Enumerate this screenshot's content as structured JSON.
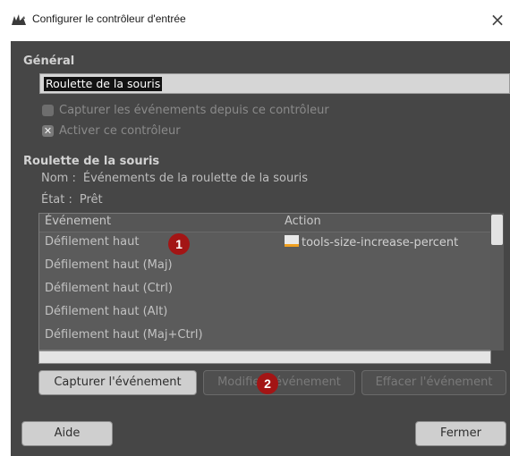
{
  "window": {
    "title": "Configurer le contrôleur d'entrée",
    "close_glyph": "×"
  },
  "general": {
    "heading": "Général",
    "name_value": "Roulette de la souris",
    "capture_label": "Capturer les événements depuis ce contrôleur",
    "capture_checked": false,
    "enable_label": "Activer ce contrôleur",
    "enable_checked": true,
    "enable_mark": "✕"
  },
  "controller": {
    "heading": "Roulette de la souris",
    "name_key": "Nom :",
    "name_value": "Événements de la roulette de la souris",
    "state_key": "État :",
    "state_value": "Prêt"
  },
  "events_table": {
    "columns": [
      "Événement",
      "Action"
    ],
    "rows": [
      {
        "event": "Défilement haut",
        "action": "tools-size-increase-percent",
        "action_icon": "action-icon"
      },
      {
        "event": "Défilement haut (Maj)",
        "action": ""
      },
      {
        "event": "Défilement haut (Ctrl)",
        "action": ""
      },
      {
        "event": "Défilement haut (Alt)",
        "action": ""
      },
      {
        "event": "Défilement haut (Maj+Ctrl)",
        "action": ""
      }
    ]
  },
  "buttons": {
    "capture": "Capturer l'événement",
    "modify": "Modifier l'événement",
    "clear": "Effacer l'événement",
    "help": "Aide",
    "close": "Fermer"
  },
  "markers": [
    "1",
    "2"
  ],
  "colors": {
    "marker": "#a31515",
    "panel_bg": "#464646"
  }
}
